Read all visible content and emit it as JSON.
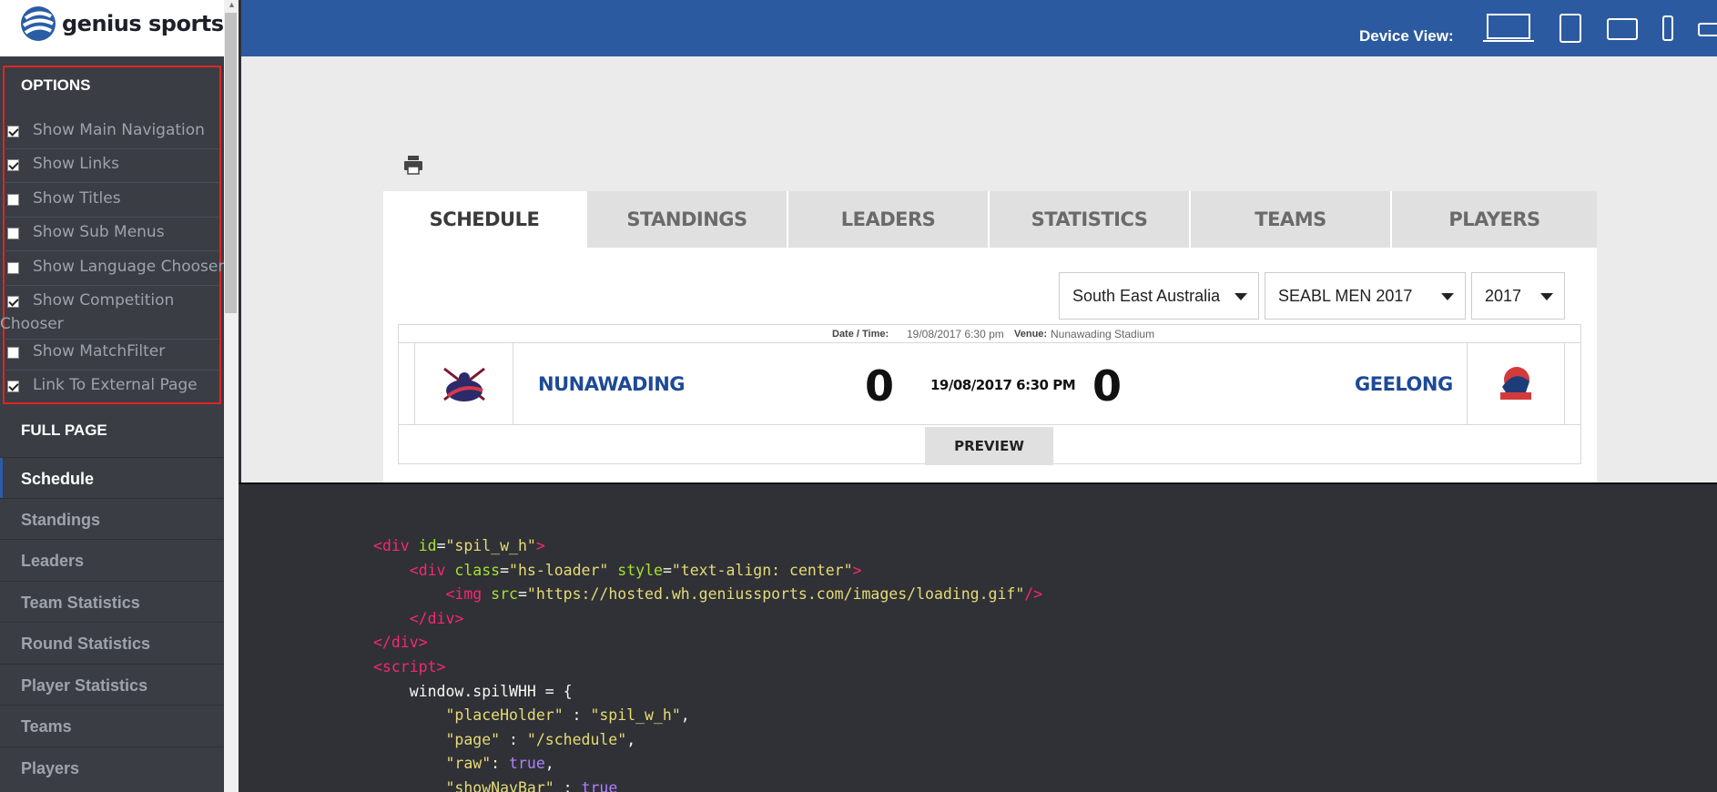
{
  "brand": {
    "name": "genius sports",
    "logo_color": "#2a5da6"
  },
  "options": {
    "title": "OPTIONS",
    "items": [
      {
        "label": "Show Main Navigation",
        "checked": true
      },
      {
        "label": "Show Links",
        "checked": true
      },
      {
        "label": "Show Titles",
        "checked": false
      },
      {
        "label": "Show Sub Menus",
        "checked": false
      },
      {
        "label": "Show Language Chooser",
        "checked": false
      },
      {
        "label": "Show Competition",
        "label_wrap": "Chooser",
        "checked": true
      },
      {
        "label": "Show MatchFilter",
        "checked": false
      },
      {
        "label": "Link To External Page",
        "checked": true
      }
    ]
  },
  "full_page": {
    "title": "FULL PAGE",
    "items": [
      "Schedule",
      "Standings",
      "Leaders",
      "Team Statistics",
      "Round Statistics",
      "Player Statistics",
      "Teams",
      "Players"
    ],
    "active": "Schedule"
  },
  "topbar": {
    "device_label": "Device View:",
    "devices": [
      "laptop-icon",
      "tablet-portrait-icon",
      "tablet-landscape-icon",
      "phone-portrait-icon",
      "phone-landscape-icon"
    ],
    "color": "#2c5aa0"
  },
  "widget": {
    "tabs": [
      "SCHEDULE",
      "STANDINGS",
      "LEADERS",
      "STATISTICS",
      "TEAMS",
      "PLAYERS"
    ],
    "active_tab": "SCHEDULE",
    "filters": {
      "region": "South East Australia",
      "competition": "SEABL MEN 2017",
      "year": "2017"
    },
    "match": {
      "date_time_label": "Date / Time:",
      "date_time": "19/08/2017 6:30 pm",
      "venue_label": "Venue:",
      "venue": "Nunawading Stadium",
      "home_team": "NUNAWADING",
      "home_score": "0",
      "time": "19/08/2017 6:30 PM",
      "away_score": "0",
      "away_team": "GEELONG",
      "preview_label": "PREVIEW"
    }
  },
  "code": {
    "lines": [
      [
        [
          "t",
          "<"
        ],
        [
          "t",
          "div"
        ],
        [
          "a",
          " id"
        ],
        [
          "p",
          "="
        ],
        [
          "s",
          "\"spil_w_h\""
        ],
        [
          "t",
          ">"
        ]
      ],
      [
        [
          "p",
          "    "
        ],
        [
          "t",
          "<"
        ],
        [
          "t",
          "div"
        ],
        [
          "a",
          " class"
        ],
        [
          "p",
          "="
        ],
        [
          "s",
          "\"hs-loader\""
        ],
        [
          "a",
          " style"
        ],
        [
          "p",
          "="
        ],
        [
          "s",
          "\"text-align: center\""
        ],
        [
          "t",
          ">"
        ]
      ],
      [
        [
          "p",
          "        "
        ],
        [
          "t",
          "<"
        ],
        [
          "t",
          "img"
        ],
        [
          "a",
          " src"
        ],
        [
          "p",
          "="
        ],
        [
          "s",
          "\"https://hosted.wh.geniussports.com/images/loading.gif\""
        ],
        [
          "t",
          "/>"
        ]
      ],
      [
        [
          "p",
          "    "
        ],
        [
          "t",
          "</"
        ],
        [
          "t",
          "div"
        ],
        [
          "t",
          ">"
        ]
      ],
      [
        [
          "t",
          "</"
        ],
        [
          "t",
          "div"
        ],
        [
          "t",
          ">"
        ]
      ],
      [
        [
          "t",
          "<"
        ],
        [
          "t",
          "script"
        ],
        [
          "t",
          ">"
        ]
      ],
      [
        [
          "p",
          "    window.spilWHH = {"
        ]
      ],
      [
        [
          "p",
          "        "
        ],
        [
          "s",
          "\"placeHolder\""
        ],
        [
          "p",
          " : "
        ],
        [
          "s",
          "\"spil_w_h\""
        ],
        [
          "p",
          ","
        ]
      ],
      [
        [
          "p",
          "        "
        ],
        [
          "s",
          "\"page\""
        ],
        [
          "p",
          " : "
        ],
        [
          "s",
          "\"/schedule\""
        ],
        [
          "p",
          ","
        ]
      ],
      [
        [
          "p",
          "        "
        ],
        [
          "s",
          "\"raw\""
        ],
        [
          "p",
          ": "
        ],
        [
          "b",
          "true"
        ],
        [
          "p",
          ","
        ]
      ],
      [
        [
          "p",
          "        "
        ],
        [
          "s",
          "\"showNavBar\""
        ],
        [
          "p",
          " : "
        ],
        [
          "b",
          "true"
        ]
      ]
    ]
  }
}
